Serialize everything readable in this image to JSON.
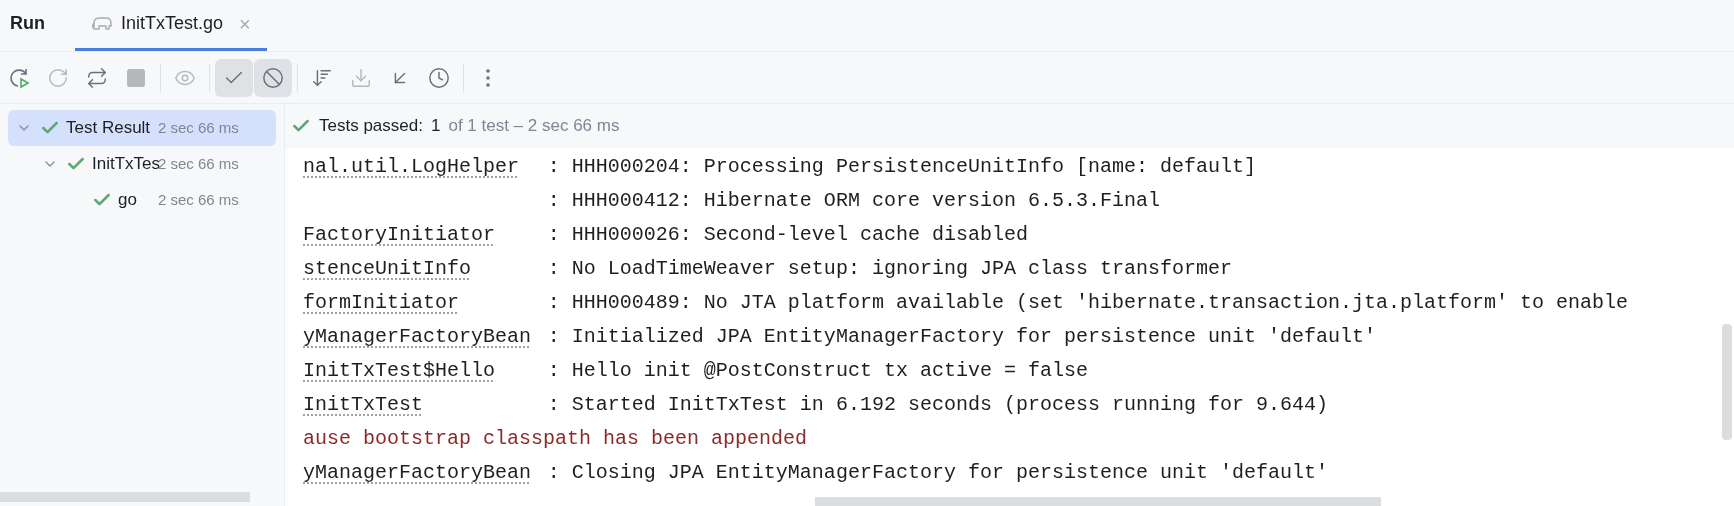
{
  "panel": {
    "title": "Run"
  },
  "tabs": [
    {
      "label": "InitTxTest.go",
      "selected": true,
      "close": "×"
    }
  ],
  "toolbar": [
    {
      "kind": "rerun",
      "disabled": false,
      "selected": false
    },
    {
      "kind": "rerun-failed",
      "disabled": true,
      "selected": false
    },
    {
      "kind": "auto-rerun",
      "disabled": false,
      "selected": false
    },
    {
      "kind": "stop",
      "disabled": true,
      "selected": false
    },
    {
      "kind": "sep"
    },
    {
      "kind": "eye",
      "disabled": true,
      "selected": false
    },
    {
      "kind": "sep"
    },
    {
      "kind": "check",
      "disabled": false,
      "selected": true
    },
    {
      "kind": "ban",
      "disabled": false,
      "selected": true
    },
    {
      "kind": "sep"
    },
    {
      "kind": "sort",
      "disabled": false,
      "selected": false
    },
    {
      "kind": "import",
      "disabled": true,
      "selected": false
    },
    {
      "kind": "collapse",
      "disabled": false,
      "selected": false
    },
    {
      "kind": "history",
      "disabled": false,
      "selected": false
    },
    {
      "kind": "sep"
    },
    {
      "kind": "more",
      "disabled": false,
      "selected": false
    }
  ],
  "tree": [
    {
      "label": "Test Result",
      "time": "2 sec 66 ms",
      "passed": true,
      "selected": true,
      "expanded": true,
      "children": [
        {
          "label": "InitTxTes",
          "time": "2 sec 66 ms",
          "passed": true,
          "selected": false,
          "expanded": true,
          "children": [
            {
              "label": "go",
              "time": "2 sec 66 ms",
              "passed": true,
              "selected": false
            }
          ]
        }
      ]
    }
  ],
  "status": {
    "passed": true,
    "label": "Tests passed:",
    "count": "1",
    "detail": "of 1 test – 2 sec 66 ms"
  },
  "console": [
    {
      "kind": "log",
      "logger": "nal.util.LogHelper",
      "message": ": HHH000204: Processing PersistenceUnitInfo [name: default]"
    },
    {
      "kind": "log",
      "message": ": HHH000412: Hibernate ORM core version 6.5.3.Final"
    },
    {
      "kind": "log",
      "logger": "FactoryInitiator",
      "message": ": HHH000026: Second-level cache disabled"
    },
    {
      "kind": "log",
      "logger": "stenceUnitInfo",
      "message": ": No LoadTimeWeaver setup: ignoring JPA class transformer"
    },
    {
      "kind": "log",
      "logger": "formInitiator",
      "message": ": HHH000489: No JTA platform available (set 'hibernate.transaction.jta.platform' to enable"
    },
    {
      "kind": "log",
      "logger": "yManagerFactoryBean",
      "message": ": Initialized JPA EntityManagerFactory for persistence unit 'default'"
    },
    {
      "kind": "log",
      "logger": "InitTxTest$Hello",
      "message": ": Hello init @PostConstruct tx active = false"
    },
    {
      "kind": "log",
      "logger": "InitTxTest",
      "message": ": Started InitTxTest in 6.192 seconds (process running for 9.644)"
    },
    {
      "kind": "error",
      "message": "ause bootstrap classpath has been appended"
    },
    {
      "kind": "log",
      "logger": "yManagerFactoryBean",
      "message": ": Closing JPA EntityManagerFactory for persistence unit 'default'"
    }
  ]
}
